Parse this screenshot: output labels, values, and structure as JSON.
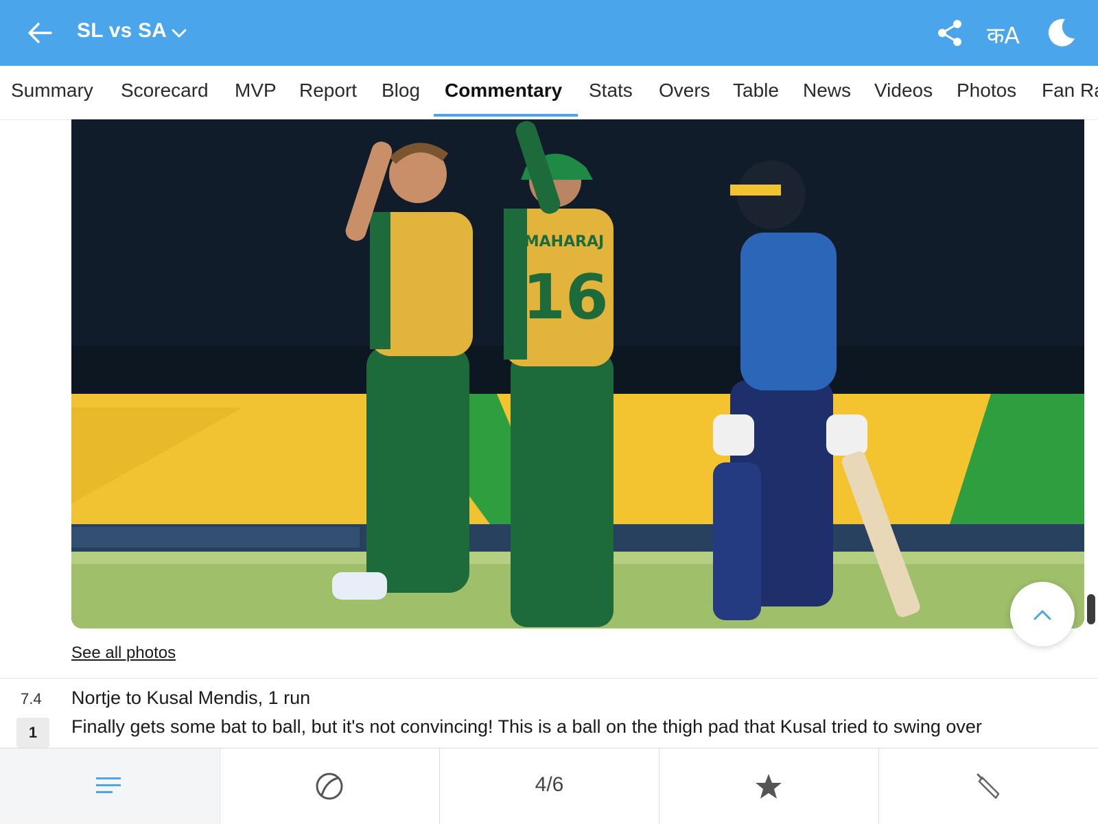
{
  "header": {
    "title": "SL vs SA",
    "lang_toggle": "कA",
    "icons": [
      "back-arrow-icon",
      "chevron-down-icon",
      "share-icon",
      "language-icon",
      "dark-mode-moon-icon"
    ],
    "background_color": "#4aa5ea"
  },
  "tabs": [
    {
      "label": "Summary"
    },
    {
      "label": "Scorecard"
    },
    {
      "label": "MVP"
    },
    {
      "label": "Report"
    },
    {
      "label": "Blog"
    },
    {
      "label": "Commentary",
      "active": true
    },
    {
      "label": "Stats"
    },
    {
      "label": "Overs"
    },
    {
      "label": "Table"
    },
    {
      "label": "News"
    },
    {
      "label": "Videos"
    },
    {
      "label": "Photos"
    },
    {
      "label": "Fan Ra"
    }
  ],
  "photo": {
    "see_all_label": "See all photos",
    "jersey_name": "MAHARAJ",
    "jersey_number": "16"
  },
  "commentary": {
    "over": "7.4",
    "runs": "1",
    "headline": "Nortje to Kusal Mendis, 1 run",
    "text": "Finally gets some bat to ball, but it's not convincing! This is a ball on the thigh pad that Kusal tried to swing over"
  },
  "bottom_nav": {
    "items": [
      {
        "icon": "commentary-list-icon"
      },
      {
        "icon": "cricket-ball-icon"
      },
      {
        "label": "4/6"
      },
      {
        "icon": "star-icon"
      },
      {
        "icon": "cricket-bat-icon"
      }
    ]
  },
  "colors": {
    "accent": "#4aa5ea",
    "tab_underline": "#4aa5ea"
  }
}
